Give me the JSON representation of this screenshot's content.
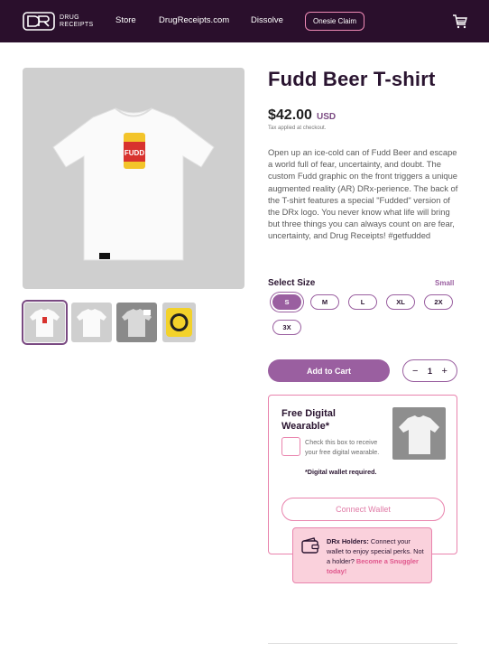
{
  "header": {
    "logo_line1": "DRUG",
    "logo_line2": "RECEIPTS",
    "nav": [
      "Store",
      "DrugReceipts.com",
      "Dissolve"
    ],
    "claim_label": "Onesie Claim"
  },
  "product": {
    "title": "Fudd Beer T-shirt",
    "price": "$42.00",
    "currency": "USD",
    "tax_note": "Tax applied at checkout.",
    "description": "Open up an ice-cold can of Fudd Beer and escape a world full of fear, uncertainty, and doubt. The custom Fudd graphic on the front triggers a unique augmented reality (AR) DRx-perience. The back of the T-shirt features a special \"Fudded\" version of the DRx logo. You never know what life will bring but three things you can always count on are fear, uncertainty, and Drug Receipts! #getfudded",
    "can_label": "FUDD"
  },
  "sizes": {
    "label": "Select Size",
    "selected_name": "Small",
    "options": [
      "S",
      "M",
      "L",
      "XL",
      "2X",
      "3X"
    ],
    "selected": "S"
  },
  "cart": {
    "add_label": "Add to Cart",
    "minus": "−",
    "qty": "1",
    "plus": "+"
  },
  "wearable": {
    "title": "Free Digital Wearable*",
    "check_text": "Check this box to receive your free digital wearable.",
    "note": "*Digital wallet required.",
    "connect_label": "Connect Wallet"
  },
  "holders": {
    "bold": "DRx Holders:",
    "text": " Connect your wallet to enjoy special perks. Not a holder?",
    "link": "Become a Snuggler today!"
  },
  "colors": {
    "header_bg": "#2a0f2c",
    "accent": "#9a5fa0",
    "pink": "#e983ad",
    "holder_bg": "#fad1dc"
  }
}
